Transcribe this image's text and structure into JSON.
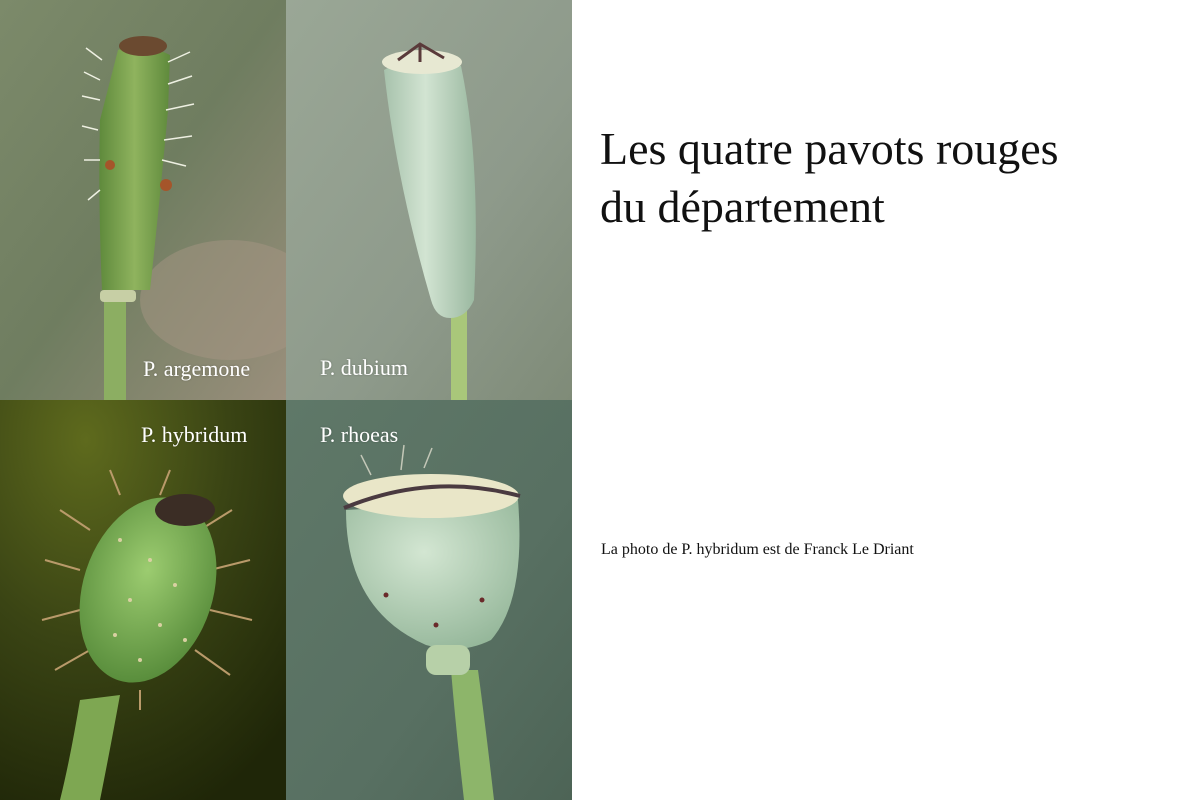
{
  "title": {
    "line1": "Les quatre pavots rouges",
    "line2": "du département"
  },
  "credit": "La photo de P. hybridum est de Franck Le Driant",
  "photos": [
    {
      "label": "P. argemone"
    },
    {
      "label": "P. dubium"
    },
    {
      "label": "P. hybridum"
    },
    {
      "label": "P. rhoeas"
    }
  ],
  "colors": {
    "background": "#ffffff",
    "label_text": "#ffffff",
    "title_text": "#111111"
  }
}
